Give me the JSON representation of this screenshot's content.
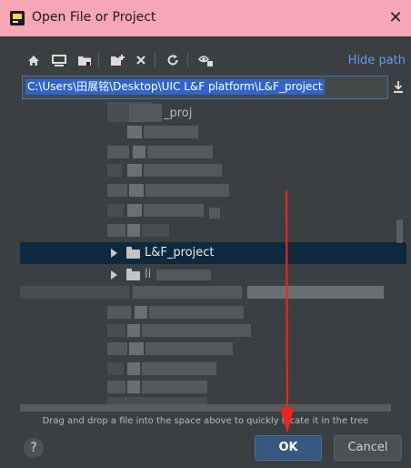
{
  "window": {
    "title": "Open File or Project",
    "close": "✕"
  },
  "toolbar": {
    "hide_path": "Hide path"
  },
  "path": {
    "value": "C:\\Users\\田展铭\\Desktop\\UIC L&F platform\\L&F_project"
  },
  "tree": {
    "top_fragment": "_proj",
    "selected_label": "L&F_project",
    "next_fragment": "li"
  },
  "hint": "Drag and drop a file into the space above to quickly locate it in the tree",
  "buttons": {
    "help": "?",
    "ok": "OK",
    "cancel": "Cancel"
  },
  "colors": {
    "titlebar": "#f7a6b6",
    "selection": "#2f65ca",
    "ok": "#365880",
    "annotation": "#e8261f",
    "link": "#589df6"
  }
}
